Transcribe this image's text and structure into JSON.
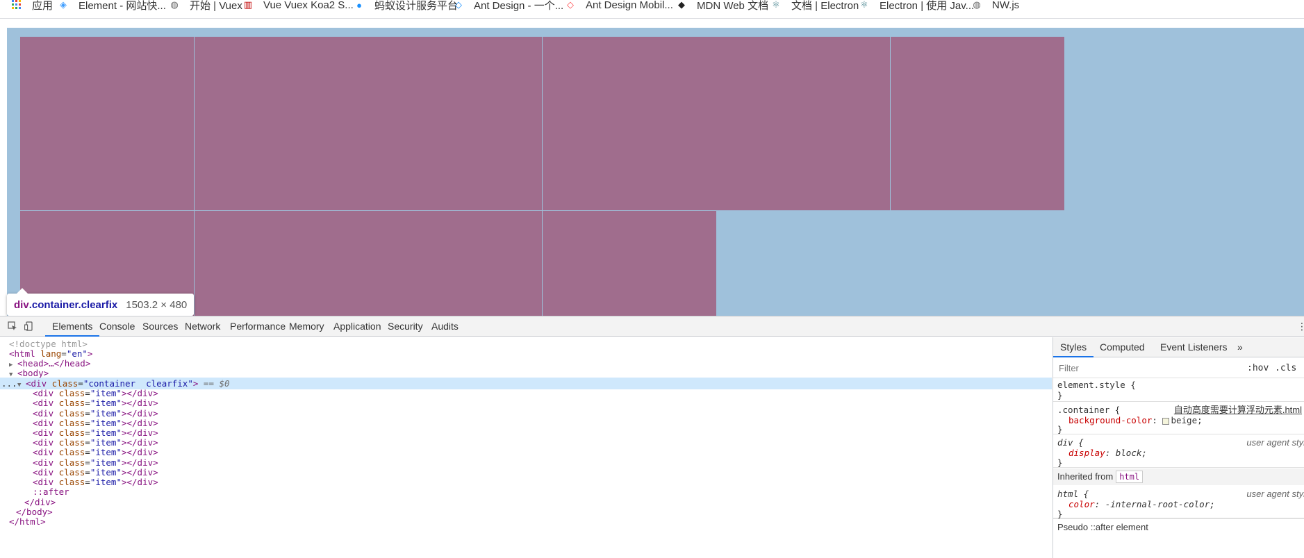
{
  "bookmarks": [
    {
      "label": "应用",
      "icon": "apps-grid-icon",
      "color": "#4285f4"
    },
    {
      "label": "Element - 网站快...",
      "icon": "element-logo-icon",
      "color": "#409eff"
    },
    {
      "label": "开始 | Vuex",
      "icon": "globe-icon",
      "color": "#666666"
    },
    {
      "label": "Vue Vuex Koa2 S...",
      "icon": "vuex-logo-icon",
      "color": "#c00000"
    },
    {
      "label": "蚂蚁设计服务平台",
      "icon": "ant-logo-icon",
      "color": "#1890ff"
    },
    {
      "label": "Ant Design - 一个...",
      "icon": "ant-design-logo-icon",
      "color": "#1890ff"
    },
    {
      "label": "Ant Design Mobil...",
      "icon": "ant-design-mobile-logo-icon",
      "color": "#ff4d4f"
    },
    {
      "label": "MDN Web 文档",
      "icon": "mdn-logo-icon",
      "color": "#222222"
    },
    {
      "label": "文档 | Electron",
      "icon": "electron-logo-icon",
      "color": "#47848f"
    },
    {
      "label": "Electron | 使用 Jav...",
      "icon": "electron-logo-icon",
      "color": "#47848f"
    },
    {
      "label": "NW.js",
      "icon": "globe-icon",
      "color": "#666666"
    }
  ],
  "page": {
    "overlay_color": "#9fc1db",
    "item_color": "#a06d8d",
    "tooltip": {
      "tag": "div",
      "classes": ".container.clearfix",
      "size": "1503.2 × 480"
    }
  },
  "devtools": {
    "tabs": [
      "Elements",
      "Console",
      "Sources",
      "Network",
      "Performance",
      "Memory",
      "Application",
      "Security",
      "Audits"
    ],
    "active_tab": "Elements",
    "dom": {
      "doctype": "<!doctype html>",
      "html_open_tag": "<html",
      "html_attr": "lang",
      "html_attr_value": "\"en\"",
      "head": "<head>…</head>",
      "body_open": "<body>",
      "container_tag": "<div",
      "container_attr": "class",
      "container_value": "\"container  clearfix\"",
      "selected_marker": "== $0",
      "item_lines": [
        "item",
        "item",
        "item",
        "item",
        "item",
        "item",
        "item",
        "item",
        "item",
        "item"
      ],
      "item_tag": "<div",
      "item_attr": "class",
      "after": "::after",
      "div_close": "</div>",
      "body_close": "</body>",
      "html_close": "</html>",
      "ellipsis": "..."
    },
    "styles": {
      "tabs": [
        "Styles",
        "Computed",
        "Event Listeners"
      ],
      "more": "»",
      "filter_placeholder": "Filter",
      "hov": ":hov",
      "cls": ".cls",
      "element_style": "element.style {",
      "close": "}",
      "container_selector": ".container {",
      "container_source": "自动高度需要计算浮动元素.html",
      "container_prop": "background-color",
      "container_value": "beige;",
      "beige_color": "#f5f5dc",
      "div_selector": "div {",
      "div_source": "user agent stylesheet",
      "div_prop": "display",
      "div_value": "block;",
      "inherited_label": "Inherited from",
      "inherited_tag": "html",
      "html_selector": "html {",
      "html_source": "user agent stylesheet",
      "html_prop": "color",
      "html_value": "-internal-root-color;",
      "pseudo_label": "Pseudo ::after element"
    }
  }
}
